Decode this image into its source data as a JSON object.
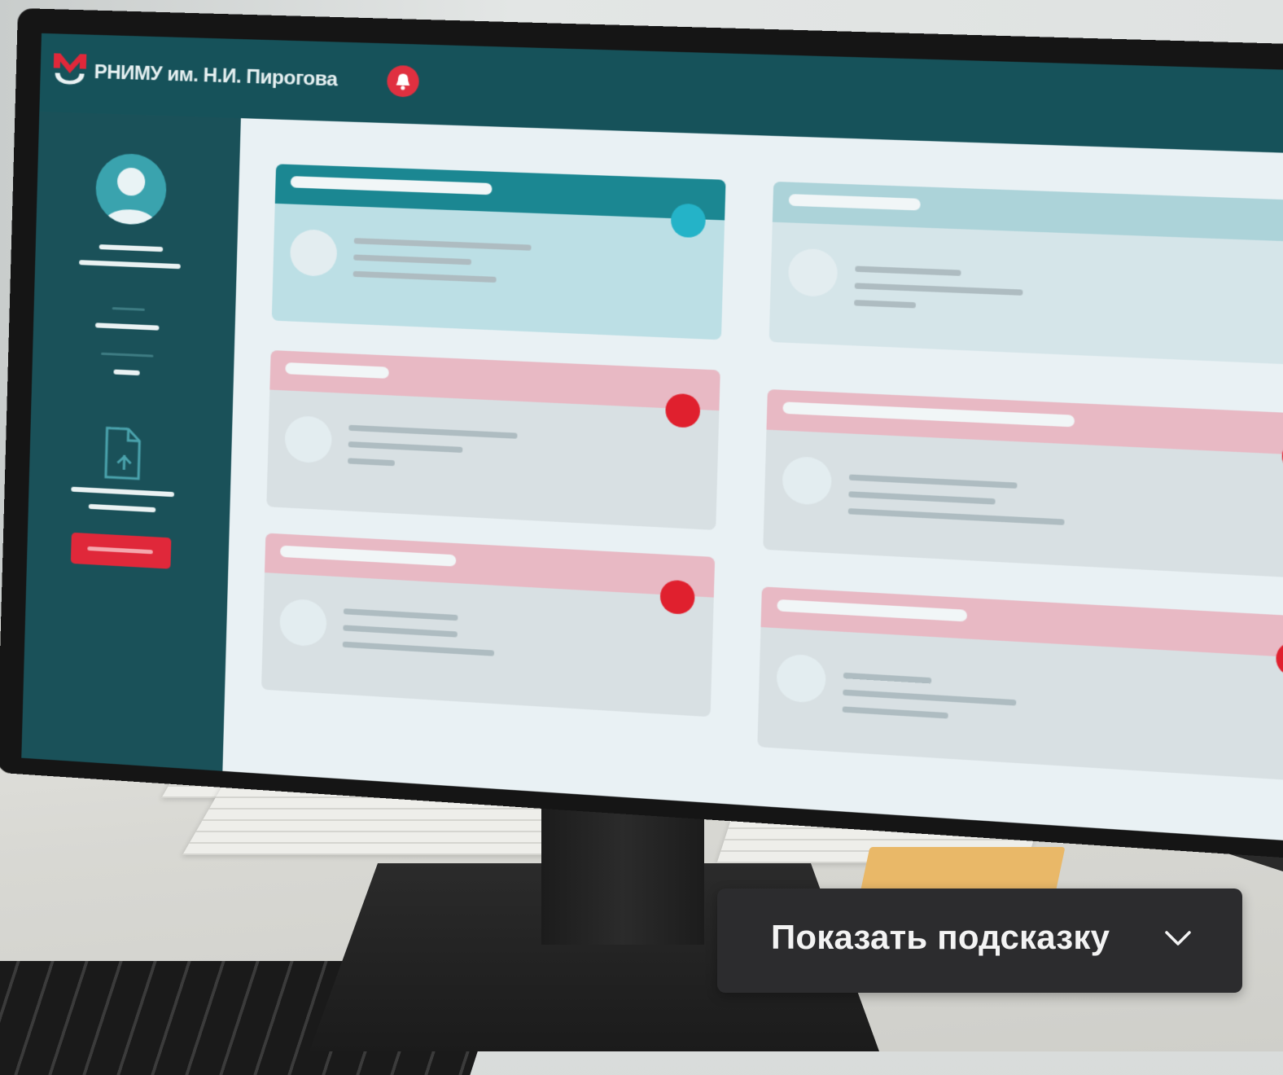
{
  "app": {
    "brand_name": "РНИМУ им. Н.И. Пирогова",
    "logo_icon": "university-logo-icon",
    "notification_icon": "bell-icon"
  },
  "colors": {
    "header_bg": "#16525a",
    "sidebar_bg": "#1a5159",
    "accent_teal": "#1b8792",
    "status_teal": "#24b3c8",
    "status_red": "#e0202e",
    "danger_button": "#e0283a",
    "card_pink_header": "#e8b9c4"
  },
  "sidebar": {
    "avatar_icon": "user-avatar-icon",
    "document_icon": "document-upload-icon",
    "action_button_icon": "red-action-button"
  },
  "cards": [
    {
      "header_style": "teal",
      "status": "teal"
    },
    {
      "header_style": "teal-light",
      "status": "teal"
    },
    {
      "header_style": "pink",
      "status": "red"
    },
    {
      "header_style": "pink",
      "status": "red"
    },
    {
      "header_style": "pink",
      "status": "red"
    },
    {
      "header_style": "pink",
      "status": "red"
    }
  ],
  "hint_button": {
    "label": "Показать подсказку",
    "icon": "chevron-down-icon"
  }
}
